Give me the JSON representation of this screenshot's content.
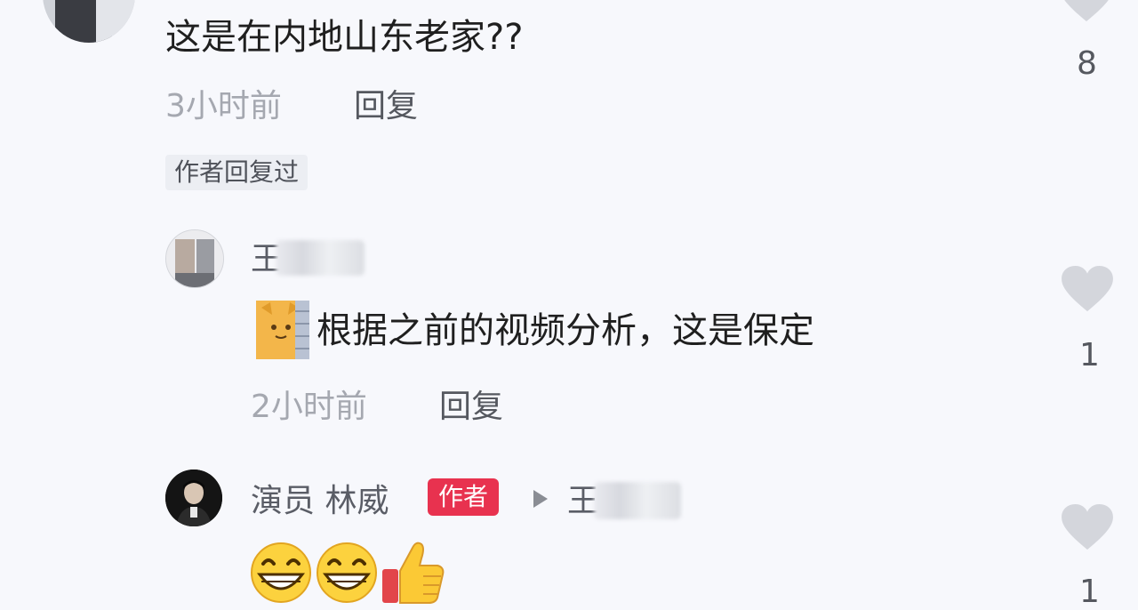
{
  "comments": [
    {
      "text": "这是在内地山东老家??",
      "time": "3小时前",
      "reply": "回复",
      "badge": "作者回复过",
      "likes": "8"
    },
    {
      "user": "王",
      "text": "根据之前的视频分析，这是保定",
      "time": "2小时前",
      "reply": "回复",
      "likes": "1"
    },
    {
      "user": "演员 林威",
      "author_label": "作者",
      "reply_to": "王",
      "likes": "1"
    }
  ],
  "colors": {
    "background": "#f7f8fc",
    "author_badge": "#e8324f",
    "like_icon": "#d4d6dc"
  },
  "icons": [
    "heart-icon",
    "cat-sticker-icon",
    "grin-emoji-icon",
    "thumbs-up-emoji-icon",
    "play-triangle-icon"
  ]
}
